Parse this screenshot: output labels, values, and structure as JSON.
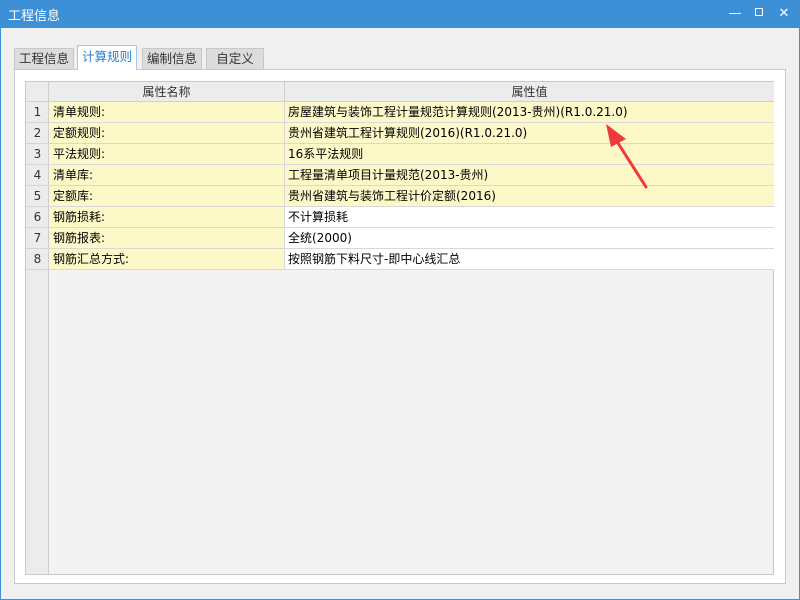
{
  "window": {
    "title": "工程信息",
    "minimize_glyph": "—",
    "close_glyph": "✕",
    "accent_color": "#3d8fd6"
  },
  "tabs": [
    {
      "label": "工程信息",
      "active": false
    },
    {
      "label": "计算规则",
      "active": true
    },
    {
      "label": "编制信息",
      "active": false
    },
    {
      "label": "自定义",
      "active": false
    }
  ],
  "grid": {
    "headers": {
      "name": "属性名称",
      "value": "属性值"
    },
    "highlight_color": "#fdf8c8",
    "rows": [
      {
        "num": "1",
        "name": "清单规则:",
        "value": "房屋建筑与装饰工程计量规范计算规则(2013-贵州)(R1.0.21.0)"
      },
      {
        "num": "2",
        "name": "定额规则:",
        "value": "贵州省建筑工程计算规则(2016)(R1.0.21.0)"
      },
      {
        "num": "3",
        "name": "平法规则:",
        "value": "16系平法规则"
      },
      {
        "num": "4",
        "name": "清单库:",
        "value": "工程量清单项目计量规范(2013-贵州)"
      },
      {
        "num": "5",
        "name": "定额库:",
        "value": "贵州省建筑与装饰工程计价定额(2016)"
      },
      {
        "num": "6",
        "name": "钢筋损耗:",
        "value": "不计算损耗"
      },
      {
        "num": "7",
        "name": "钢筋报表:",
        "value": "全统(2000)"
      },
      {
        "num": "8",
        "name": "钢筋汇总方式:",
        "value": "按照钢筋下料尺寸-即中心线汇总"
      }
    ]
  },
  "annotation": {
    "type": "arrow",
    "color": "#f03a3a"
  }
}
